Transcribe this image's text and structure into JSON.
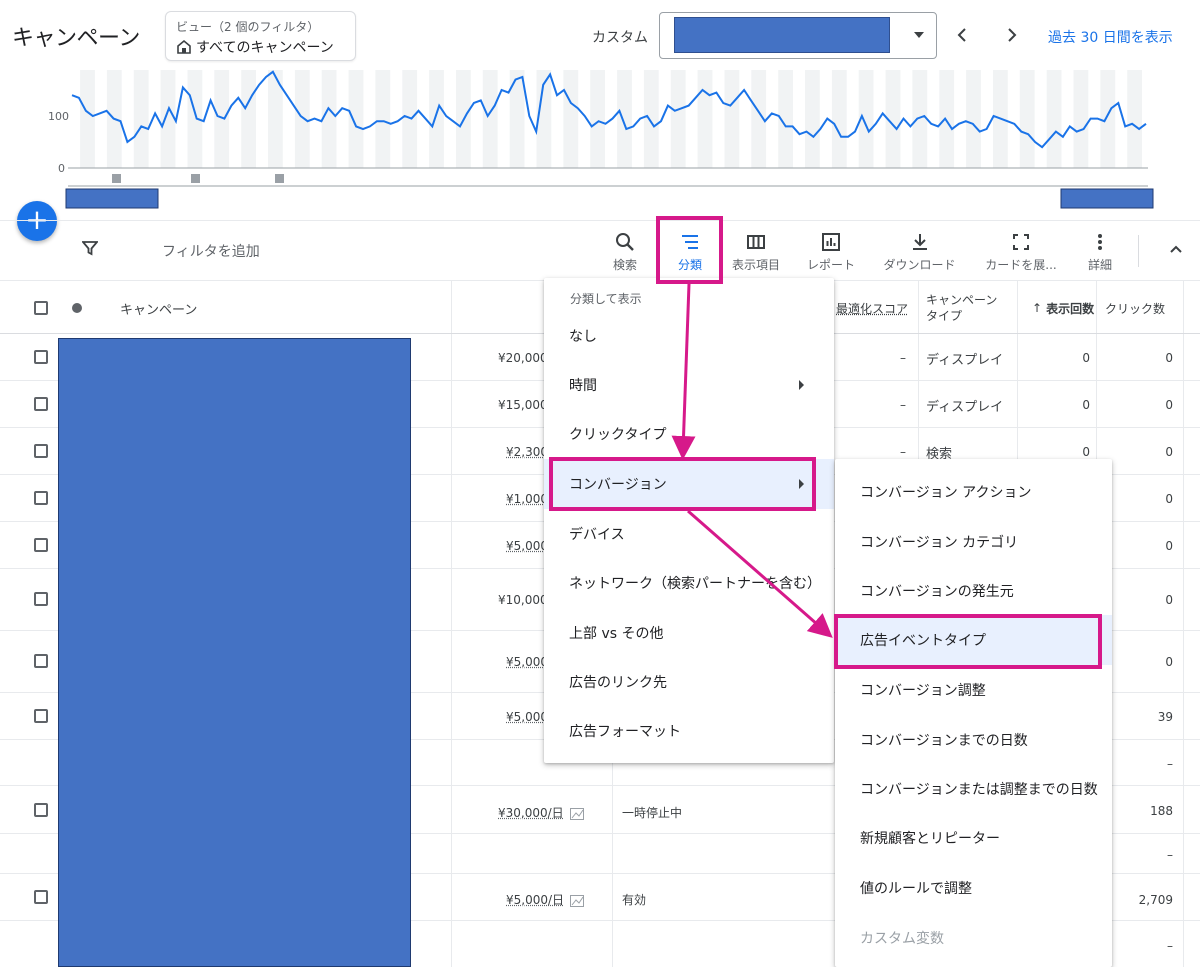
{
  "header": {
    "title": "キャンペーン",
    "view_label": "ビュー（2 個のフィルタ）",
    "view_value": "すべてのキャンペーン",
    "custom_label": "カスタム",
    "show_last_30": "過去 30 日間を表示"
  },
  "chart_data": {
    "type": "line",
    "y_ticks": [
      "100",
      "0"
    ],
    "series_color": "#1a73e8",
    "values": [
      140,
      135,
      110,
      100,
      105,
      110,
      95,
      90,
      50,
      60,
      80,
      75,
      105,
      80,
      115,
      90,
      155,
      140,
      95,
      90,
      130,
      100,
      95,
      120,
      135,
      115,
      140,
      160,
      175,
      185,
      160,
      140,
      120,
      100,
      90,
      95,
      90,
      115,
      100,
      115,
      110,
      80,
      75,
      80,
      90,
      90,
      85,
      90,
      100,
      95,
      110,
      95,
      80,
      120,
      100,
      90,
      80,
      105,
      125,
      130,
      100,
      120,
      150,
      145,
      170,
      175,
      100,
      70,
      160,
      180,
      140,
      150,
      125,
      115,
      100,
      80,
      90,
      85,
      95,
      110,
      75,
      80,
      95,
      100,
      80,
      90,
      120,
      110,
      115,
      120,
      135,
      150,
      140,
      145,
      125,
      120,
      135,
      150,
      130,
      110,
      90,
      105,
      100,
      80,
      80,
      65,
      70,
      60,
      75,
      95,
      85,
      60,
      60,
      70,
      100,
      70,
      85,
      105,
      90,
      75,
      95,
      80,
      95,
      100,
      85,
      80,
      95,
      75,
      85,
      90,
      85,
      70,
      75,
      100,
      95,
      90,
      85,
      70,
      65,
      50,
      40,
      55,
      70,
      60,
      80,
      70,
      75,
      95,
      95,
      90,
      115,
      125,
      80,
      85,
      75,
      85
    ]
  },
  "toolbar": {
    "add_filter": "フィルタを追加",
    "search": "検索",
    "segment": "分類",
    "columns": "表示項目",
    "reports": "レポート",
    "download": "ダウンロード",
    "expand": "カードを展...",
    "more": "詳細"
  },
  "table": {
    "headers": {
      "campaign": "キャンペーン",
      "opt_score": "最適化スコア",
      "type": "キャンペーン\nタイプ",
      "impressions": "表示回数",
      "clicks": "クリック数"
    },
    "rows": [
      {
        "budget": "¥20,000",
        "opt": "–",
        "type": "ディスプレイ",
        "impr": "0",
        "clicks": "0"
      },
      {
        "budget": "¥15,000",
        "opt": "–",
        "type": "ディスプレイ",
        "impr": "0",
        "clicks": "0"
      },
      {
        "budget": "¥2,300",
        "opt": "–",
        "type": "検索",
        "impr": "0",
        "clicks": "0"
      },
      {
        "budget": "¥1,000",
        "clicks": "0"
      },
      {
        "budget": "¥5,000",
        "clicks": "0"
      },
      {
        "budget": "¥10,000",
        "clicks": "0"
      },
      {
        "budget": "¥5,000",
        "clicks": "0"
      },
      {
        "budget": "¥5,000",
        "clicks": "39"
      },
      {
        "clicks": "–"
      },
      {
        "budget": "¥30,000/日",
        "status": "一時停止中",
        "clicks": "188"
      },
      {
        "clicks": "–"
      },
      {
        "budget": "¥5,000/日",
        "status": "有効",
        "clicks": "2,709"
      },
      {
        "clicks": "–"
      }
    ]
  },
  "segment_menu": {
    "heading": "分類して表示",
    "items": [
      "なし",
      "時間",
      "クリックタイプ",
      "コンバージョン",
      "デバイス",
      "ネットワーク（検索パートナーを含む）",
      "上部 vs その他",
      "広告のリンク先",
      "広告フォーマット"
    ]
  },
  "conversion_submenu": {
    "items": [
      "コンバージョン アクション",
      "コンバージョン カテゴリ",
      "コンバージョンの発生元",
      "広告イベントタイプ",
      "コンバージョン調整",
      "コンバージョンまでの日数",
      "コンバージョンまたは調整までの日数",
      "新規顧客とリピーター",
      "値のルールで調整",
      "カスタム変数"
    ]
  },
  "colors": {
    "accent": "#1a73e8",
    "highlight": "#d6198a",
    "redaction": "#4472c4"
  }
}
